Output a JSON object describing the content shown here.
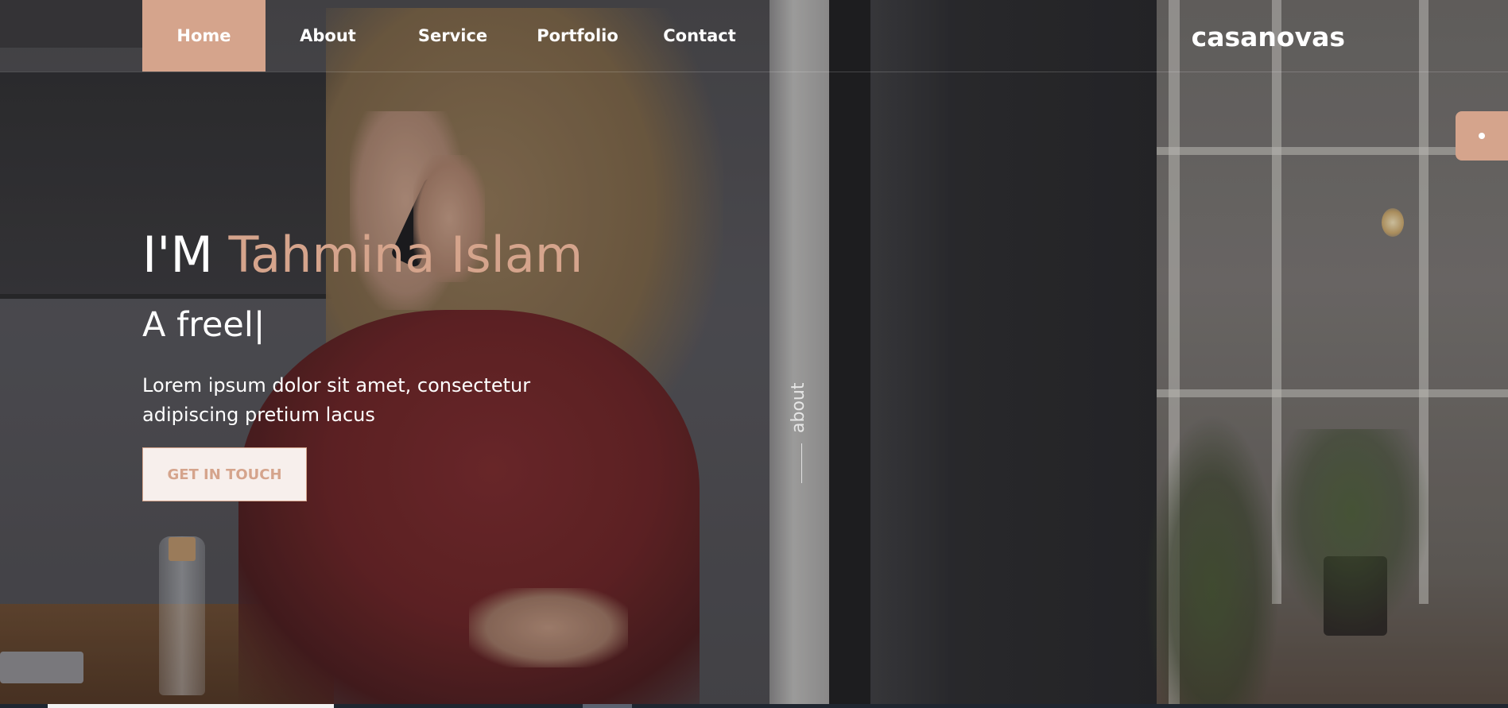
{
  "nav": {
    "items": [
      {
        "label": "Home",
        "active": true
      },
      {
        "label": "About",
        "active": false
      },
      {
        "label": "Service",
        "active": false
      },
      {
        "label": "Portfolio",
        "active": false
      },
      {
        "label": "Contact",
        "active": false
      }
    ]
  },
  "brand": {
    "logo": "casanovas"
  },
  "hero": {
    "title_prefix": "I'M ",
    "title_name": "Tahmina Islam",
    "typed_text": "A freel|",
    "description_line1": "Lorem ipsum dolor sit amet, consectetur",
    "description_line2": "adipiscing pretium lacus",
    "cta_label": "GET IN TOUCH"
  },
  "side": {
    "about_label": "about"
  },
  "colors": {
    "accent": "#d5a48c",
    "text": "#ffffff",
    "cta_bg": "#f7efec"
  }
}
